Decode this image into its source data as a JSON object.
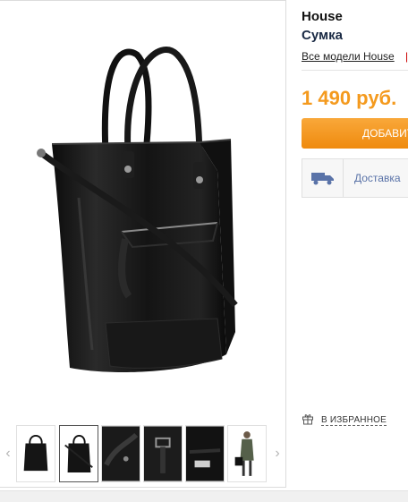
{
  "product": {
    "brand": "House",
    "type": "Сумка",
    "all_models_link": "Все модели House",
    "separator": "|",
    "price": "1 490 руб.",
    "add_to_cart": "ДОБАВИТЬ В КОРЗИНУ",
    "delivery_text": "Доставка",
    "favorites": "В ИЗБРАННОЕ"
  },
  "gallery": {
    "selected_index": 1,
    "thumbnails": [
      {
        "content": "bag-front-handles-up"
      },
      {
        "content": "bag-front-shoulder-strap"
      },
      {
        "content": "bag-detail-handle"
      },
      {
        "content": "bag-detail-buckle"
      },
      {
        "content": "bag-interior-label"
      },
      {
        "content": "model-wearing-bag"
      }
    ],
    "prev_arrow": "‹",
    "next_arrow": "›"
  },
  "colors": {
    "price": "#f49a1e",
    "button": "#f39417",
    "link_blue": "#5a73a8"
  }
}
